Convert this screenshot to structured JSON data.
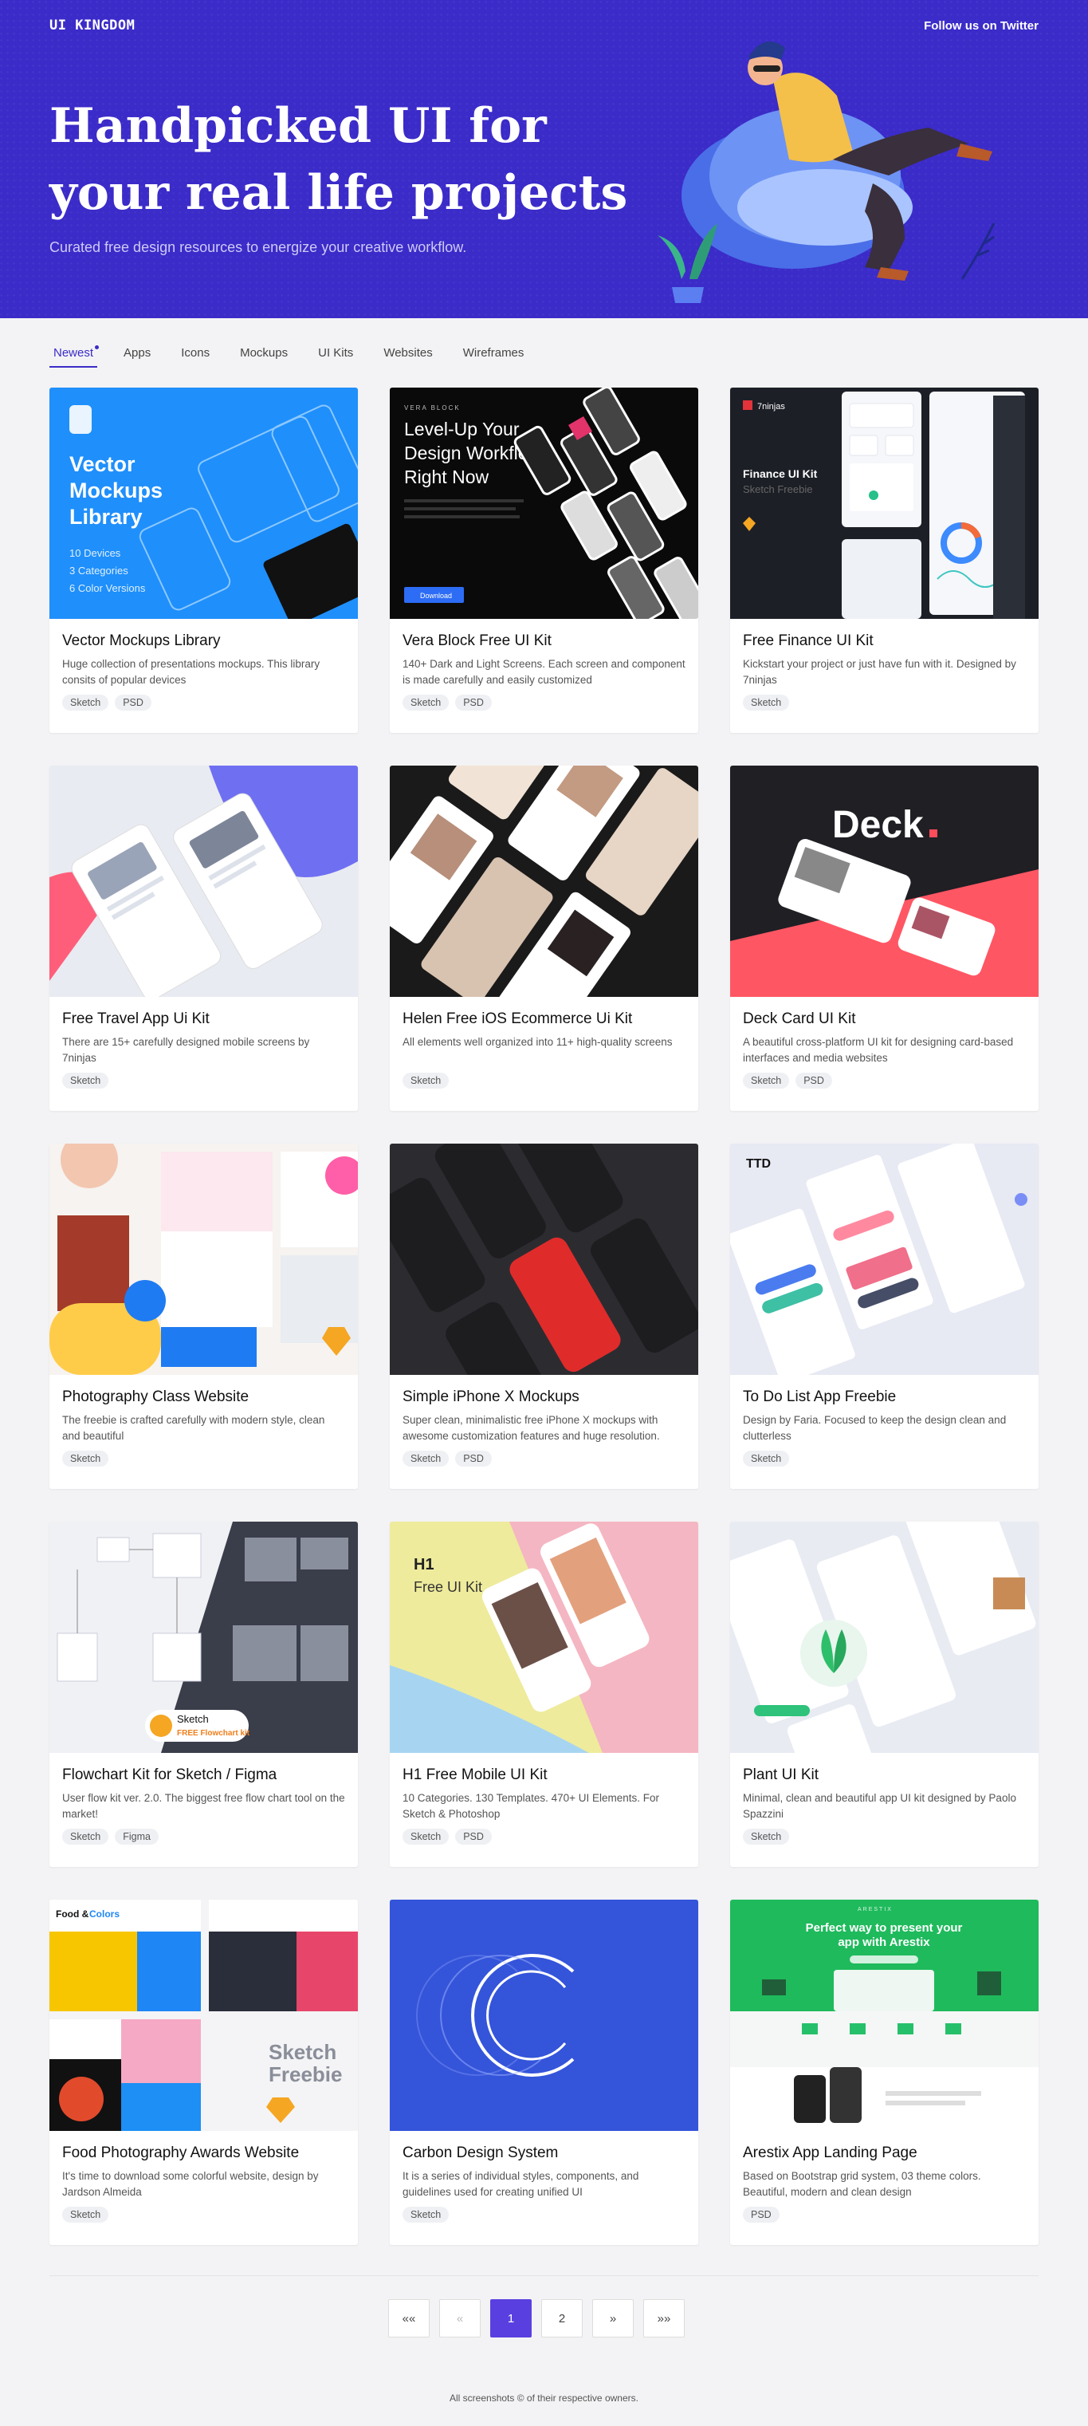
{
  "header": {
    "brand": "UI KINGDOM",
    "follow": "Follow us on Twitter"
  },
  "hero": {
    "line1": "Handpicked UI for",
    "line2": "your real life projects",
    "subtitle": "Curated free design resources to energize your creative workflow."
  },
  "tabs": [
    {
      "label": "Newest"
    },
    {
      "label": "Apps"
    },
    {
      "label": "Icons"
    },
    {
      "label": "Mockups"
    },
    {
      "label": "UI Kits"
    },
    {
      "label": "Websites"
    },
    {
      "label": "Wireframes"
    }
  ],
  "cards": [
    {
      "title": "Vector Mockups Library",
      "desc": "Huge collection of presentations mockups. This library consits of popular devices",
      "tags": [
        "Sketch",
        "PSD"
      ],
      "t1": "Vector",
      "t2": "Mockups",
      "t3": "Library",
      "t4": "10 Devices",
      "t5": "3 Categories",
      "t6": "6 Color Versions"
    },
    {
      "title": "Vera Block Free UI Kit",
      "desc": "140+ Dark and Light Screens. Each screen and component is made carefully and easily customized",
      "tags": [
        "Sketch",
        "PSD"
      ],
      "t0": "VERA BLOCK",
      "t1": "Level-Up Your",
      "t2": "Design Workflow",
      "t3": "Right Now",
      "t4": "Download"
    },
    {
      "title": "Free Finance UI Kit",
      "desc": "Kickstart your project or just have fun with it. Designed by 7ninjas",
      "tags": [
        "Sketch"
      ],
      "t0": "7ninjas",
      "t1": "Finance UI Kit",
      "t2": "Sketch Freebie"
    },
    {
      "title": "Free Travel App Ui Kit",
      "desc": "There are 15+ carefully designed mobile screens by 7ninjas",
      "tags": [
        "Sketch"
      ]
    },
    {
      "title": "Helen Free iOS Ecommerce Ui Kit",
      "desc": "All elements well organized into 11+ high-quality screens",
      "tags": [
        "Sketch"
      ]
    },
    {
      "title": "Deck Card UI Kit",
      "desc": "A beautiful cross-platform UI kit for designing card-based interfaces and media websites",
      "tags": [
        "Sketch",
        "PSD"
      ],
      "t1": "Deck"
    },
    {
      "title": "Photography Class Website",
      "desc": "The freebie is crafted carefully with modern style, clean and beautiful",
      "tags": [
        "Sketch"
      ]
    },
    {
      "title": "Simple iPhone X Mockups",
      "desc": "Super clean, minimalistic free iPhone X mockups with awesome customization features and huge resolution.",
      "tags": [
        "Sketch",
        "PSD"
      ]
    },
    {
      "title": "To Do List App Freebie",
      "desc": "Design by Faria. Focused to keep the design clean and clutterless",
      "tags": [
        "Sketch"
      ],
      "t1": "TTD"
    },
    {
      "title": "Flowchart Kit for Sketch / Figma",
      "desc": "User flow kit ver. 2.0. The biggest free flow chart tool on the market!",
      "tags": [
        "Sketch",
        "Figma"
      ],
      "t1": "Sketch",
      "t2": "FREE Flowchart kit"
    },
    {
      "title": "H1 Free Mobile UI Kit",
      "desc": "10 Categories. 130 Templates. 470+ UI Elements. For Sketch & Photoshop",
      "tags": [
        "Sketch",
        "PSD"
      ],
      "t1": "H1",
      "t2": "Free UI Kit"
    },
    {
      "title": "Plant UI Kit",
      "desc": "Minimal, clean and beautiful app UI kit designed by Paolo Spazzini",
      "tags": [
        "Sketch"
      ]
    },
    {
      "title": "Food Photography Awards Website",
      "desc": "It's time to download some colorful website, design by Jardson Almeida",
      "tags": [
        "Sketch"
      ],
      "t1": "Food &",
      "t2": "Colors",
      "t3": "Sketch",
      "t4": "Freebie"
    },
    {
      "title": "Carbon Design System",
      "desc": "It is a series of individual styles, components, and guidelines used for creating unified UI",
      "tags": [
        "Sketch"
      ]
    },
    {
      "title": "Arestix App Landing Page",
      "desc": "Based on Bootstrap grid system, 03 theme colors. Beautiful, modern and clean design",
      "tags": [
        "PSD"
      ],
      "t0": "ARESTIX",
      "t1": "Perfect way to present your",
      "t2": "app with Arestix"
    }
  ],
  "pagination": {
    "first": "««",
    "prev": "«",
    "pages": [
      "1",
      "2"
    ],
    "next": "»",
    "last": "»»"
  },
  "footer": "All screenshots © of their respective owners."
}
